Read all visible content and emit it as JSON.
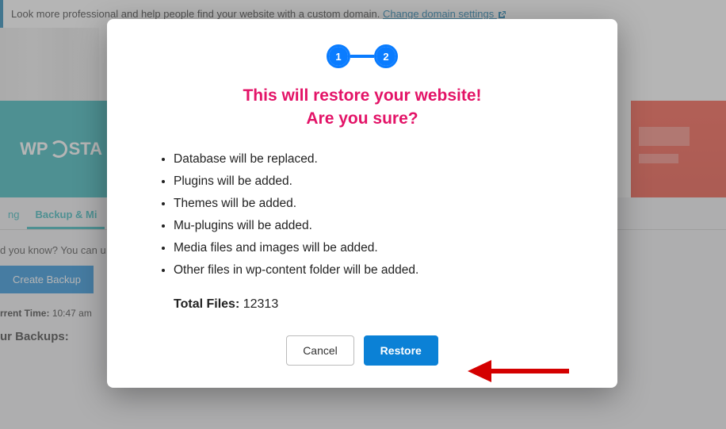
{
  "notice": {
    "text": "Look more professional and help people find your website with a custom domain.",
    "link": "Change domain settings"
  },
  "banner": {
    "brand_left": "WP",
    "brand_right": "STA"
  },
  "tabs": {
    "first": "ng",
    "active": "Backup & Mi"
  },
  "hint": "d you know? You can u",
  "create_backup": "Create Backup",
  "time": {
    "label": "rrent Time:",
    "value": "10:47 am"
  },
  "backups_heading": "ur Backups:",
  "modal": {
    "step1": "1",
    "step2": "2",
    "title_line1": "This will restore your website!",
    "title_line2": "Are you sure?",
    "items": [
      "Database will be replaced.",
      "Plugins will be added.",
      "Themes will be added.",
      "Mu-plugins will be added.",
      "Media files and images will be added.",
      "Other files in wp-content folder will be added."
    ],
    "total_label": "Total Files:",
    "total_value": "12313",
    "cancel": "Cancel",
    "restore": "Restore"
  }
}
